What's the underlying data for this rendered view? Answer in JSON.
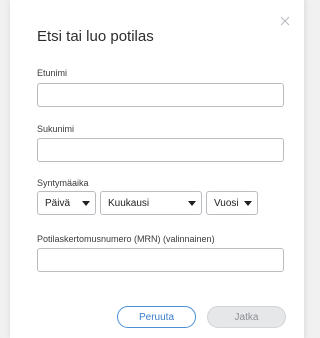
{
  "dialog": {
    "title": "Etsi tai luo potilas",
    "fields": {
      "first_name_label": "Etunimi",
      "first_name_value": "",
      "last_name_label": "Sukunimi",
      "last_name_value": "",
      "dob_label": "Syntymäaika",
      "day_selected": "Päivä",
      "month_selected": "Kuukausi",
      "year_selected": "Vuosi",
      "mrn_label": "Potilaskertomusnumero (MRN) (valinnainen)",
      "mrn_value": ""
    },
    "buttons": {
      "cancel_label": "Peruuta",
      "continue_label": "Jatka"
    }
  },
  "colors": {
    "accent": "#4a90d9",
    "disabled_bg": "#e6e7e9"
  }
}
